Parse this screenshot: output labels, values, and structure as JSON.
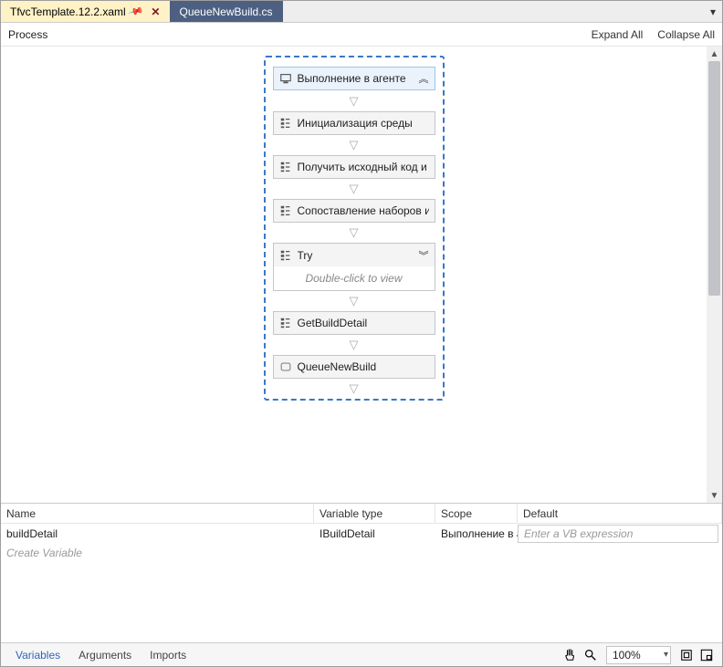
{
  "tabs": [
    {
      "label": "TfvcTemplate.12.2.xaml",
      "active": true
    },
    {
      "label": "QueueNewBuild.cs",
      "active": false
    }
  ],
  "toolbar": {
    "left": "Process",
    "expand": "Expand All",
    "collapse": "Collapse All"
  },
  "workflow": {
    "container_title": "Выполнение в агенте",
    "activities": [
      {
        "label": "Инициализация среды",
        "kind": "seq"
      },
      {
        "label": "Получить исходный код и",
        "kind": "seq"
      },
      {
        "label": "Сопоставление наборов и",
        "kind": "seq"
      },
      {
        "label": "Try",
        "kind": "try",
        "expandable": true,
        "hint": "Double-click to view"
      },
      {
        "label": "GetBuildDetail",
        "kind": "seq"
      },
      {
        "label": "QueueNewBuild",
        "kind": "code"
      }
    ]
  },
  "grid": {
    "headers": {
      "name": "Name",
      "type": "Variable type",
      "scope": "Scope",
      "default": "Default"
    },
    "rows": [
      {
        "name": "buildDetail",
        "type": "IBuildDetail",
        "scope": "Выполнение в аген",
        "default": "",
        "placeholder": "Enter a VB expression"
      }
    ],
    "create": "Create Variable"
  },
  "bottombar": {
    "tabs": [
      {
        "label": "Variables",
        "active": true
      },
      {
        "label": "Arguments",
        "active": false
      },
      {
        "label": "Imports",
        "active": false
      }
    ],
    "zoom": "100%"
  }
}
